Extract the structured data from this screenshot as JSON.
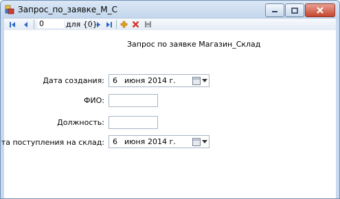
{
  "window": {
    "title": "Запрос_по_заявке_М_С",
    "icon": "form-app-icon",
    "caption_buttons": [
      "minimize-icon",
      "maximize-icon",
      "close-icon"
    ]
  },
  "toolbar": {
    "position_value": "0",
    "of_label": "для {0}",
    "buttons": [
      "move-first-icon",
      "move-previous-icon",
      "move-next-icon",
      "move-last-icon",
      "add-new-icon",
      "delete-icon",
      "save-icon"
    ]
  },
  "form": {
    "heading": "Запрос по заявке Магазин_Склад",
    "created_date": {
      "label": "Дата создания:",
      "day": "6",
      "month": "июня",
      "year": "2014 г."
    },
    "fio": {
      "label": "ФИО:",
      "value": ""
    },
    "position": {
      "label": "Должность:",
      "value": ""
    },
    "warehouse_date": {
      "label": "Дата поступления на склад:",
      "day": "6",
      "month": "июня",
      "year": "2014 г."
    }
  },
  "colors": {
    "titlebar": "#c3d6ec",
    "frame": "#c9daee",
    "accent_blue": "#2a66c7",
    "delete_red": "#d8322a",
    "add_orange": "#e5a019"
  }
}
